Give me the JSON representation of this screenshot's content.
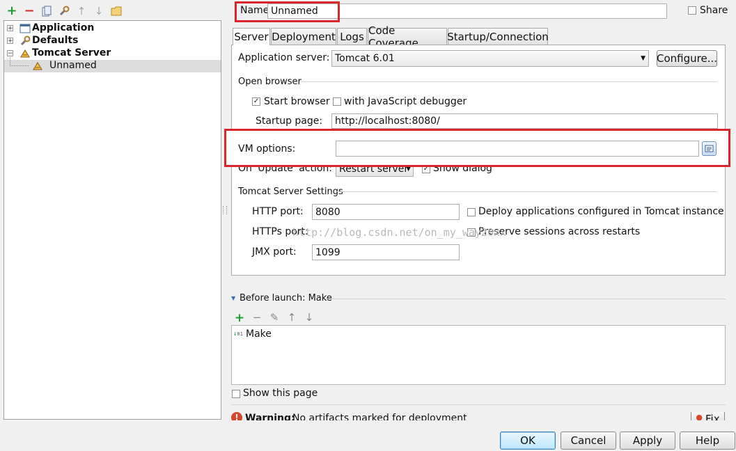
{
  "toolbar": {
    "add": "+",
    "remove": "−",
    "copy_icon": "copy-icon",
    "settings_icon": "wrench-icon",
    "up": "↑",
    "down": "↓",
    "folder_icon": "folder-icon"
  },
  "tree": {
    "items": [
      {
        "label": "Application",
        "expander": "+"
      },
      {
        "label": "Defaults",
        "expander": "+"
      },
      {
        "label": "Tomcat Server",
        "expander": "−"
      },
      {
        "label": "Unnamed"
      }
    ]
  },
  "header": {
    "name_label": "Name:",
    "name_value": "Unnamed",
    "share_label": "Share"
  },
  "tabs": [
    "Server",
    "Deployment",
    "Logs",
    "Code Coverage",
    "Startup/Connection"
  ],
  "server": {
    "app_server_label": "Application server:",
    "app_server_value": "Tomcat 6.01",
    "configure_label": "Configure...",
    "open_browser_title": "Open browser",
    "start_browser_label": "Start browser",
    "js_debugger_label": "with JavaScript debugger",
    "startup_page_label": "Startup page:",
    "startup_page_value": "http://localhost:8080/",
    "vm_options_label": "VM options:",
    "vm_options_value": "",
    "on_update_label": "On 'Update' action:",
    "on_update_value": "Restart server",
    "show_dialog_label": "Show dialog",
    "tomcat_settings_title": "Tomcat Server Settings",
    "http_port_label": "HTTP port:",
    "http_port_value": "8080",
    "https_port_label": "HTTPs port:",
    "jmx_port_label": "JMX port:",
    "jmx_port_value": "1099",
    "deploy_apps_label": "Deploy applications configured in Tomcat instance",
    "preserve_sessions_label": "Preserve sessions across restarts",
    "watermark": "http://blog.csdn.net/on_my_way20xx"
  },
  "before_launch": {
    "title": "Before launch: Make",
    "items": [
      "Make"
    ],
    "add": "+",
    "remove": "−",
    "edit_icon": "pencil-icon",
    "up": "↑",
    "down": "↓"
  },
  "show_this_page_label": "Show this page",
  "warning": {
    "bold": "Warning:",
    "text": "No artifacts marked for deployment",
    "fix_label": "Fix"
  },
  "buttons": {
    "ok": "OK",
    "cancel": "Cancel",
    "apply": "Apply",
    "help": "Help"
  },
  "colors": {
    "highlight_red": "#d9252b",
    "selected_row": "#dcdcdc",
    "add_green": "#1e9a2e",
    "remove_red": "#d02a2a"
  }
}
